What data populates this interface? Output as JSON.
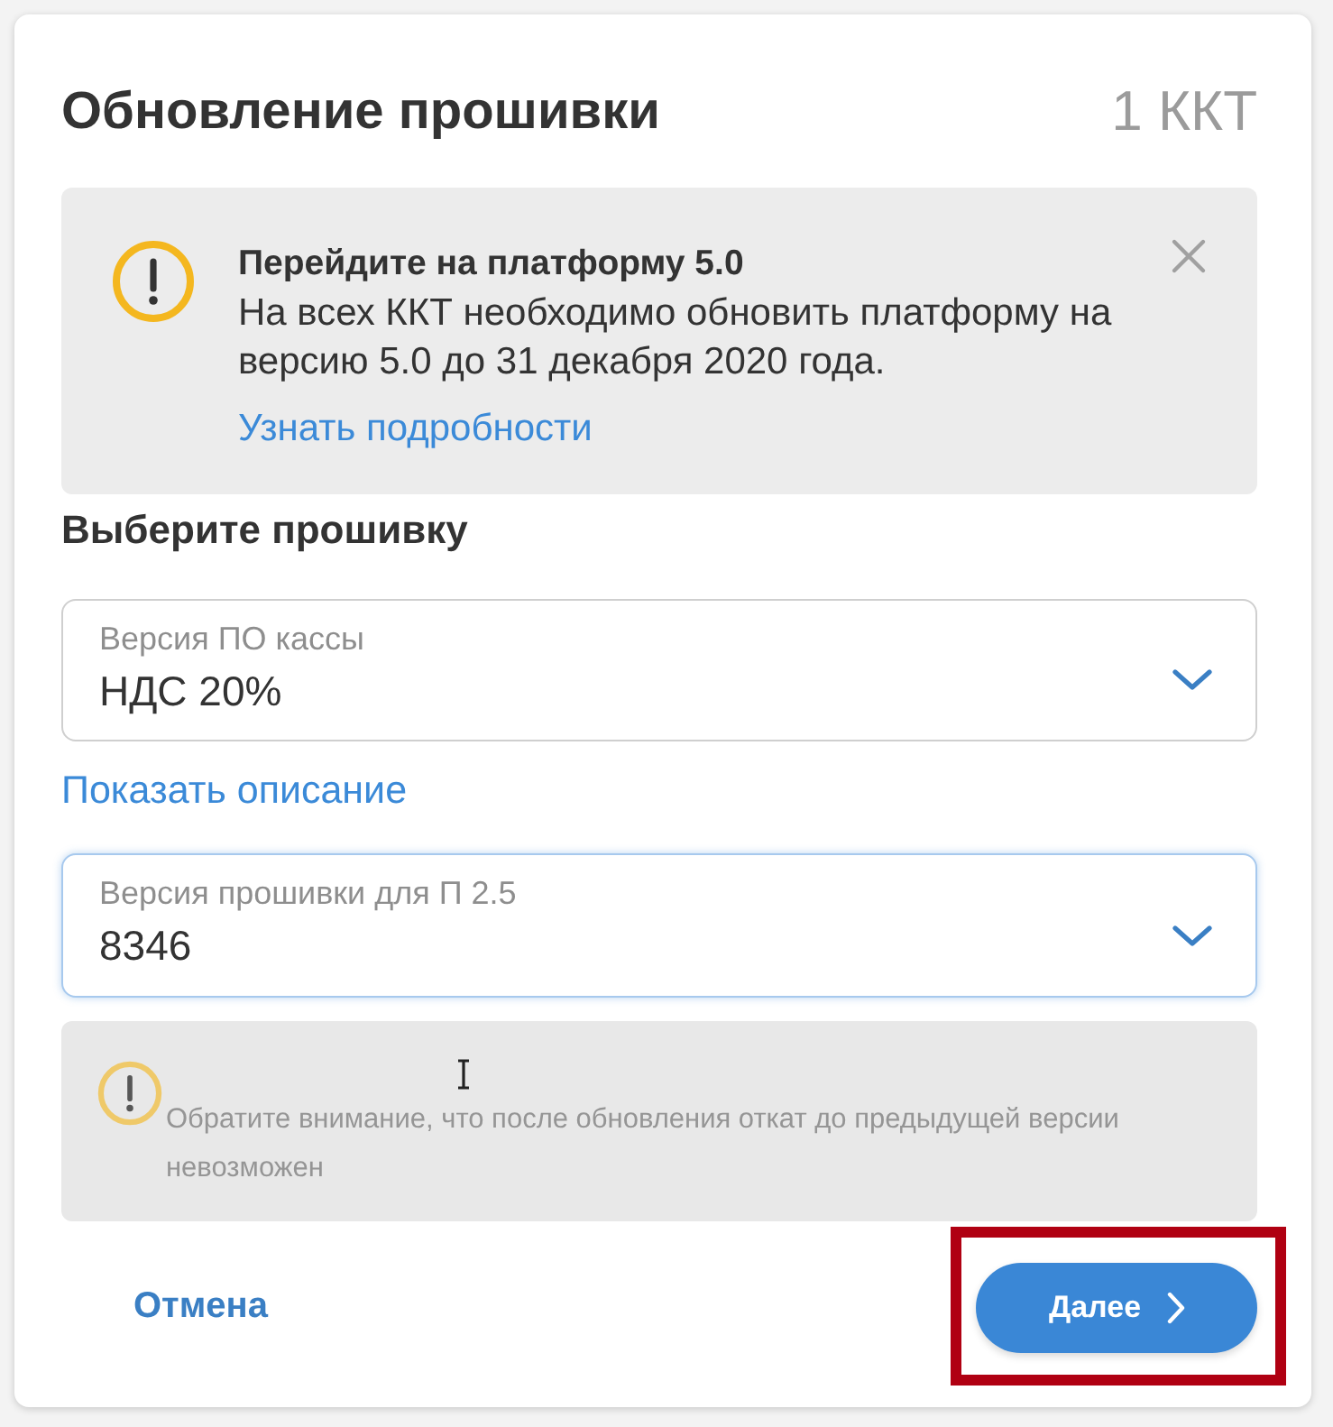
{
  "dialog": {
    "title": "Обновление прошивки",
    "device_count": "1 ККТ"
  },
  "notice": {
    "title": "Перейдите на платформу 5.0",
    "text": "На всех ККТ необходимо обновить платформу на версию 5.0 до 31 декабря 2020 года.",
    "link": "Узнать подробности",
    "closable": true
  },
  "section_title": "Выберите прошивку",
  "fields": [
    {
      "label": "Версия ПО кассы",
      "value": "НДС 20%",
      "focused": false,
      "link": "Показать описание"
    },
    {
      "label": "Версия прошивки для П 2.5",
      "value": "8346",
      "focused": true
    }
  ],
  "note": {
    "text": "Обратите внимание, что после обновления откат до предыдущей версии невозможен",
    "disabled": true
  },
  "footer": {
    "cancel": "Отмена",
    "next": {
      "label": "Далее",
      "highlighted": true
    }
  }
}
